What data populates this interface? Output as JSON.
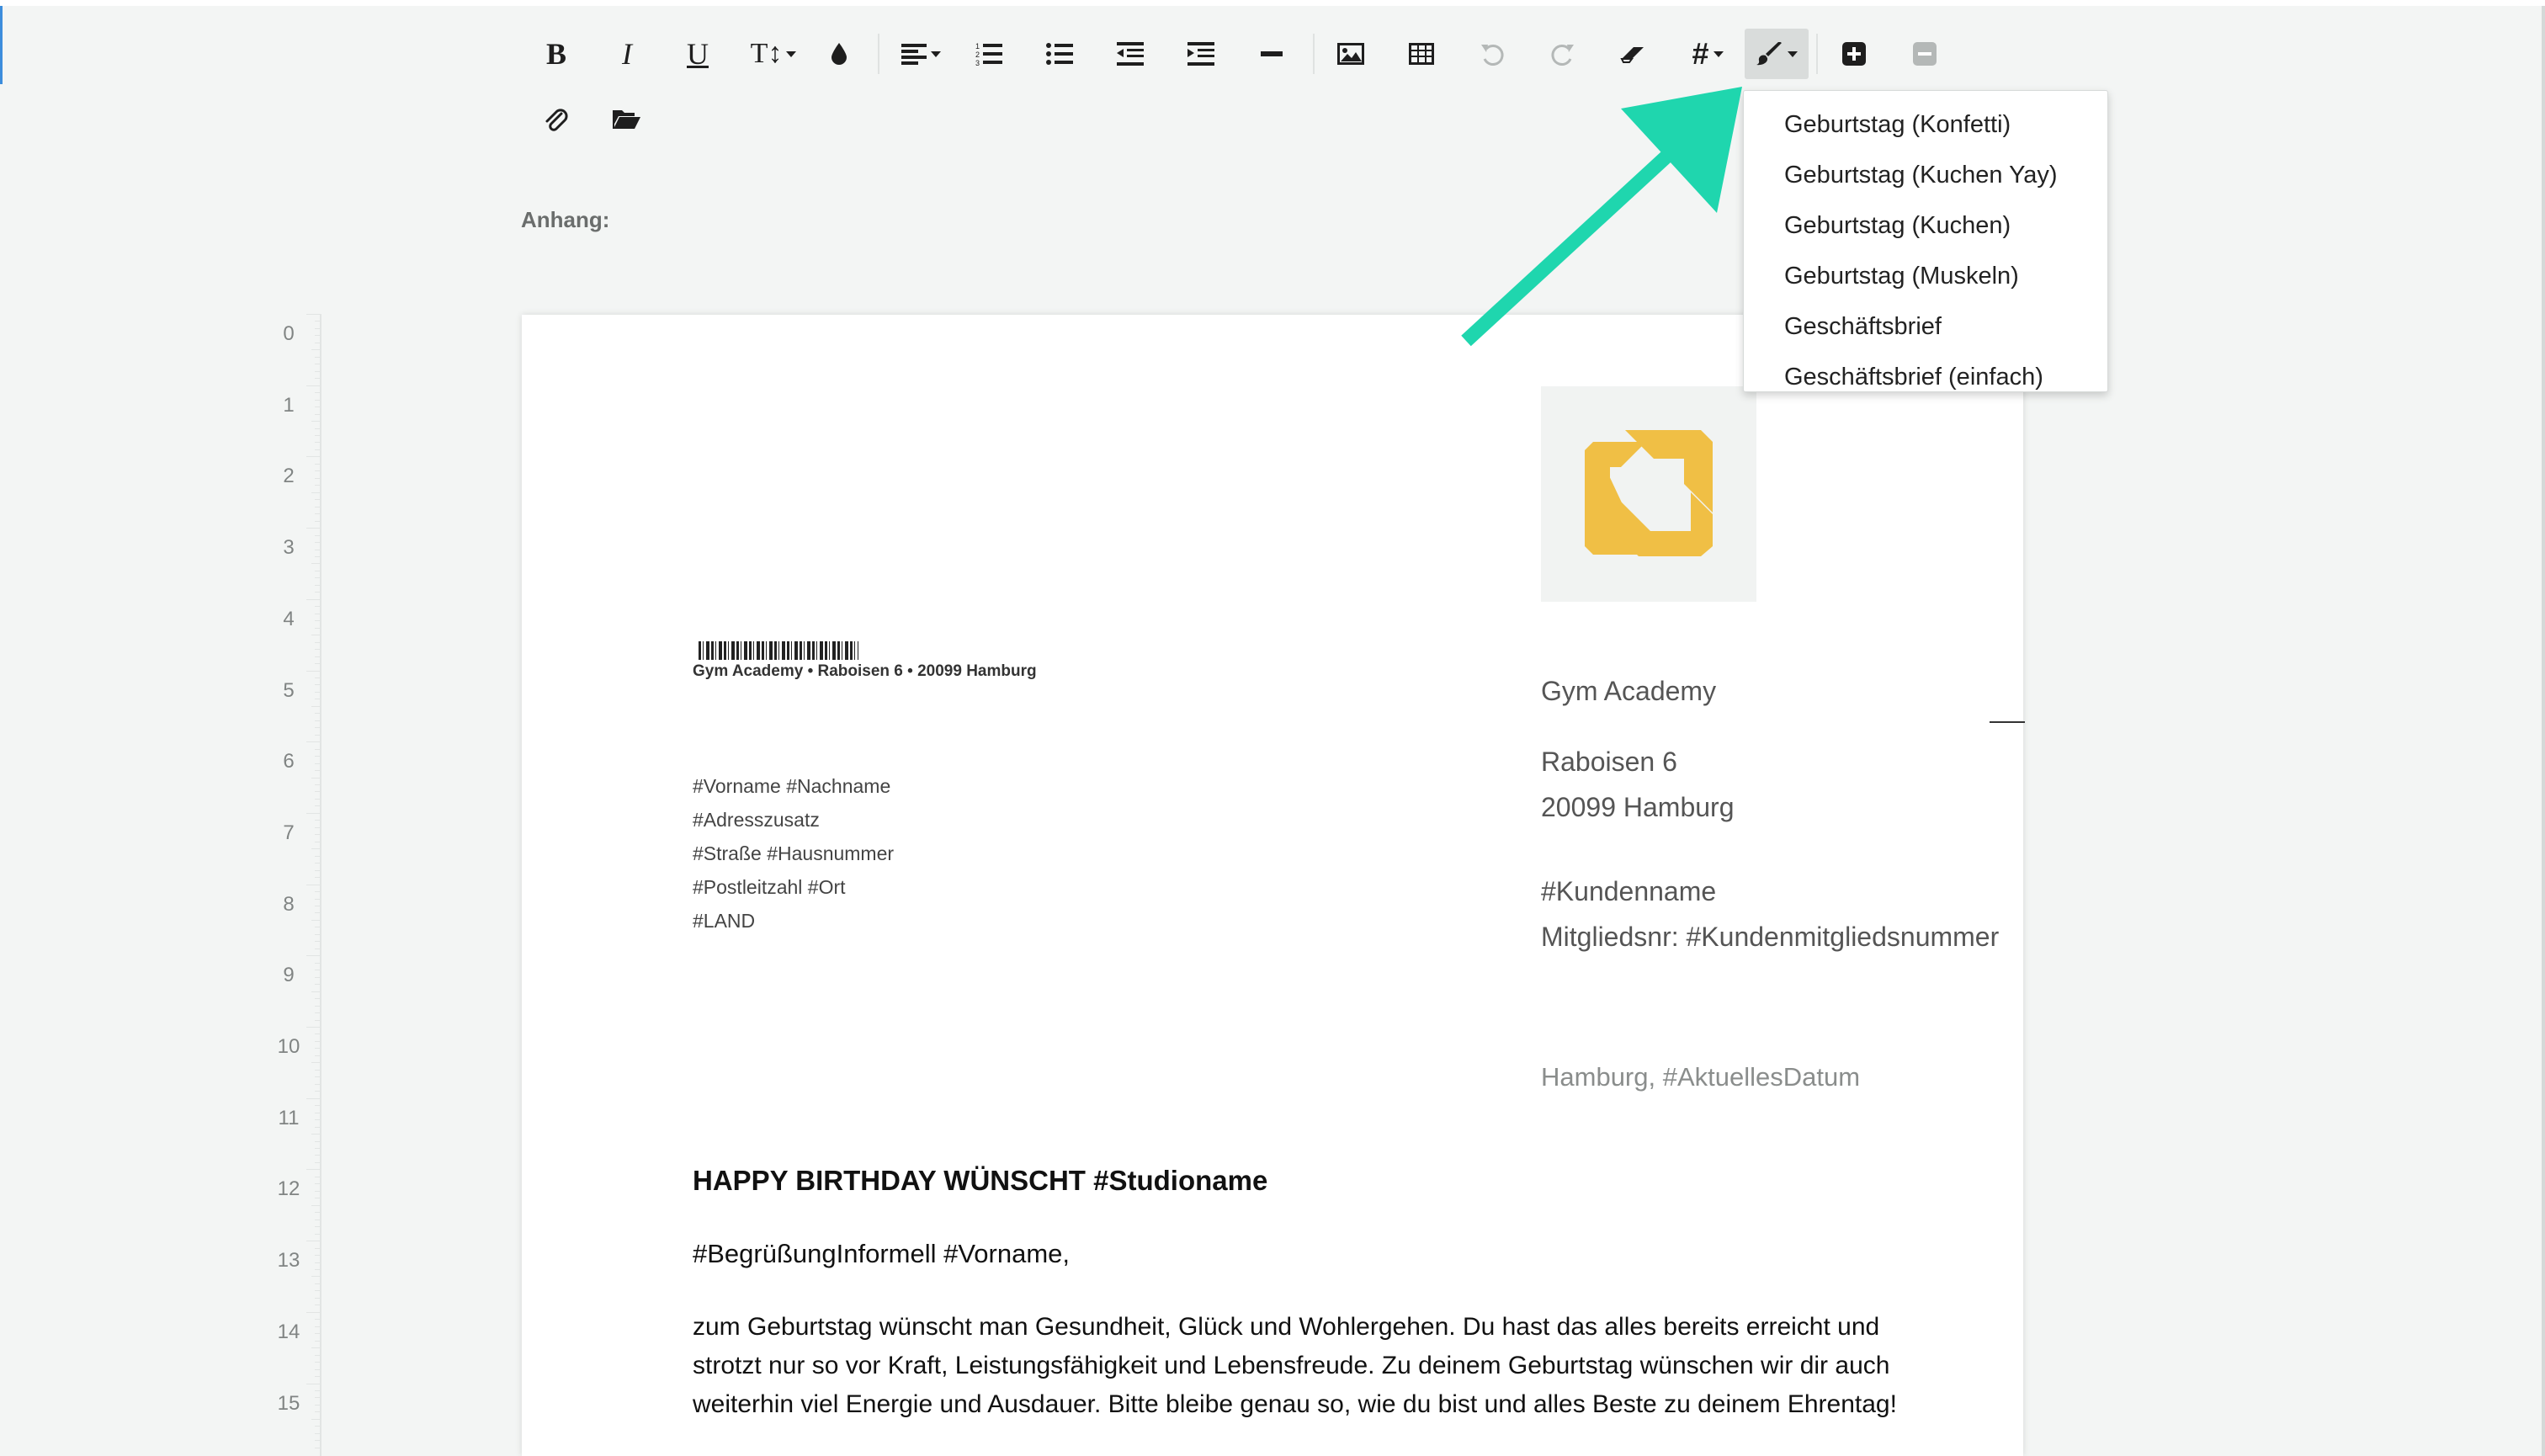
{
  "toolbar": {
    "bold_label": "B",
    "italic_label": "I",
    "underline_label": "U",
    "textsize_label": "T↕",
    "tags_label": "#"
  },
  "attachment": {
    "label": "Anhang:"
  },
  "ruler": {
    "marks": [
      "0",
      "1",
      "2",
      "3",
      "4",
      "5",
      "6",
      "7",
      "8",
      "9",
      "10",
      "11",
      "12",
      "13",
      "14",
      "15"
    ]
  },
  "template_menu": {
    "items": [
      "Geburtstag (Konfetti)",
      "Geburtstag (Kuchen Yay)",
      "Geburtstag (Kuchen)",
      "Geburtstag (Muskeln)",
      "Geschäftsbrief",
      "Geschäftsbrief (einfach)"
    ]
  },
  "letter": {
    "sender_line": "Gym Academy  •  Raboisen 6  •  20099 Hamburg",
    "recipient": [
      "#Vorname #Nachname",
      "#Adresszusatz",
      "#Straße #Hausnummer",
      "#Postleitzahl #Ort",
      "#LAND"
    ],
    "company_name": "Gym Academy",
    "street": "Raboisen 6",
    "city": "20099 Hamburg",
    "customer_name": "#Kundenname",
    "member_number": "Mitgliedsnr: #Kundenmitgliedsnummer",
    "date_line": "Hamburg, #AktuellesDatum",
    "heading": "HAPPY BIRTHDAY WÜNSCHT #Studioname",
    "greeting": "#BegrüßungInformell #Vorname,",
    "body": "zum Geburtstag wünscht man Gesundheit, Glück und Wohlergehen. Du hast das alles bereits erreicht und strotzt nur so vor Kraft, Leistungsfähigkeit und Lebensfreude. Zu deinem Geburtstag wünschen wir dir auch weiterhin viel Energie und Ausdauer. Bitte bleibe genau so, wie du bist und alles Beste zu deinem Ehrentag!"
  },
  "colors": {
    "arrow": "#1fd6ae",
    "logo": "#f0bf45",
    "background": "#f3f5f4"
  },
  "icons": [
    "bold-icon",
    "italic-icon",
    "underline-icon",
    "text-size-icon",
    "color-drop-icon",
    "align-icon",
    "ordered-list-icon",
    "bullet-list-icon",
    "outdent-icon",
    "indent-icon",
    "horizontal-rule-icon",
    "image-icon",
    "table-icon",
    "undo-icon",
    "redo-icon",
    "eraser-icon",
    "hash-icon",
    "brush-icon",
    "plus-box-icon",
    "minus-box-icon",
    "paperclip-icon",
    "folder-icon"
  ]
}
